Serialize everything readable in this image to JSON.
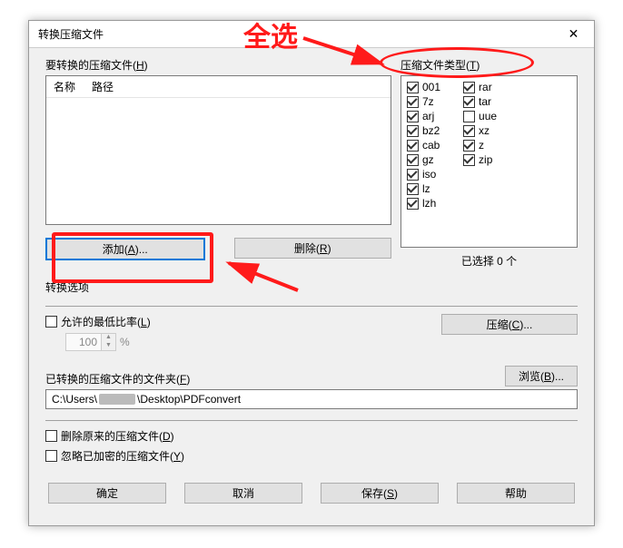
{
  "window": {
    "title": "转换压缩文件",
    "close_glyph": "✕"
  },
  "files": {
    "label_pre": "要转换的压缩文件(",
    "label_key": "H",
    "label_post": ")",
    "col1": "名称",
    "col2": "路径"
  },
  "types": {
    "label_pre": "压缩文件类型(",
    "label_key": "T",
    "label_post": ")",
    "left": [
      {
        "name": "001",
        "checked": true
      },
      {
        "name": "7z",
        "checked": true
      },
      {
        "name": "arj",
        "checked": true
      },
      {
        "name": "bz2",
        "checked": true
      },
      {
        "name": "cab",
        "checked": true
      },
      {
        "name": "gz",
        "checked": true
      },
      {
        "name": "iso",
        "checked": true
      },
      {
        "name": "lz",
        "checked": true
      },
      {
        "name": "lzh",
        "checked": true
      }
    ],
    "right": [
      {
        "name": "rar",
        "checked": true
      },
      {
        "name": "tar",
        "checked": true
      },
      {
        "name": "uue",
        "checked": false
      },
      {
        "name": "xz",
        "checked": true
      },
      {
        "name": "z",
        "checked": true
      },
      {
        "name": "zip",
        "checked": true
      }
    ],
    "selected_count": "已选择 0 个"
  },
  "buttons": {
    "add": "添加(A)...",
    "remove": "删除(R)",
    "compress": "压缩(C)...",
    "browse": "浏览(B)...",
    "ok": "确定",
    "cancel": "取消",
    "save": "保存(S)",
    "help": "帮助"
  },
  "options": {
    "section_label": "转换选项",
    "min_ratio": "允许的最低比率(L)",
    "min_ratio_value": "100",
    "percent": "%",
    "folder_label": "已转换的压缩文件的文件夹(F)",
    "folder_path_pre": "C:\\Users\\",
    "folder_path_post": "\\Desktop\\PDFconvert",
    "delete_orig": "删除原来的压缩文件(D)",
    "ignore_enc": "忽略已加密的压缩文件(Y)"
  },
  "annotations": {
    "select_all": "全选"
  }
}
